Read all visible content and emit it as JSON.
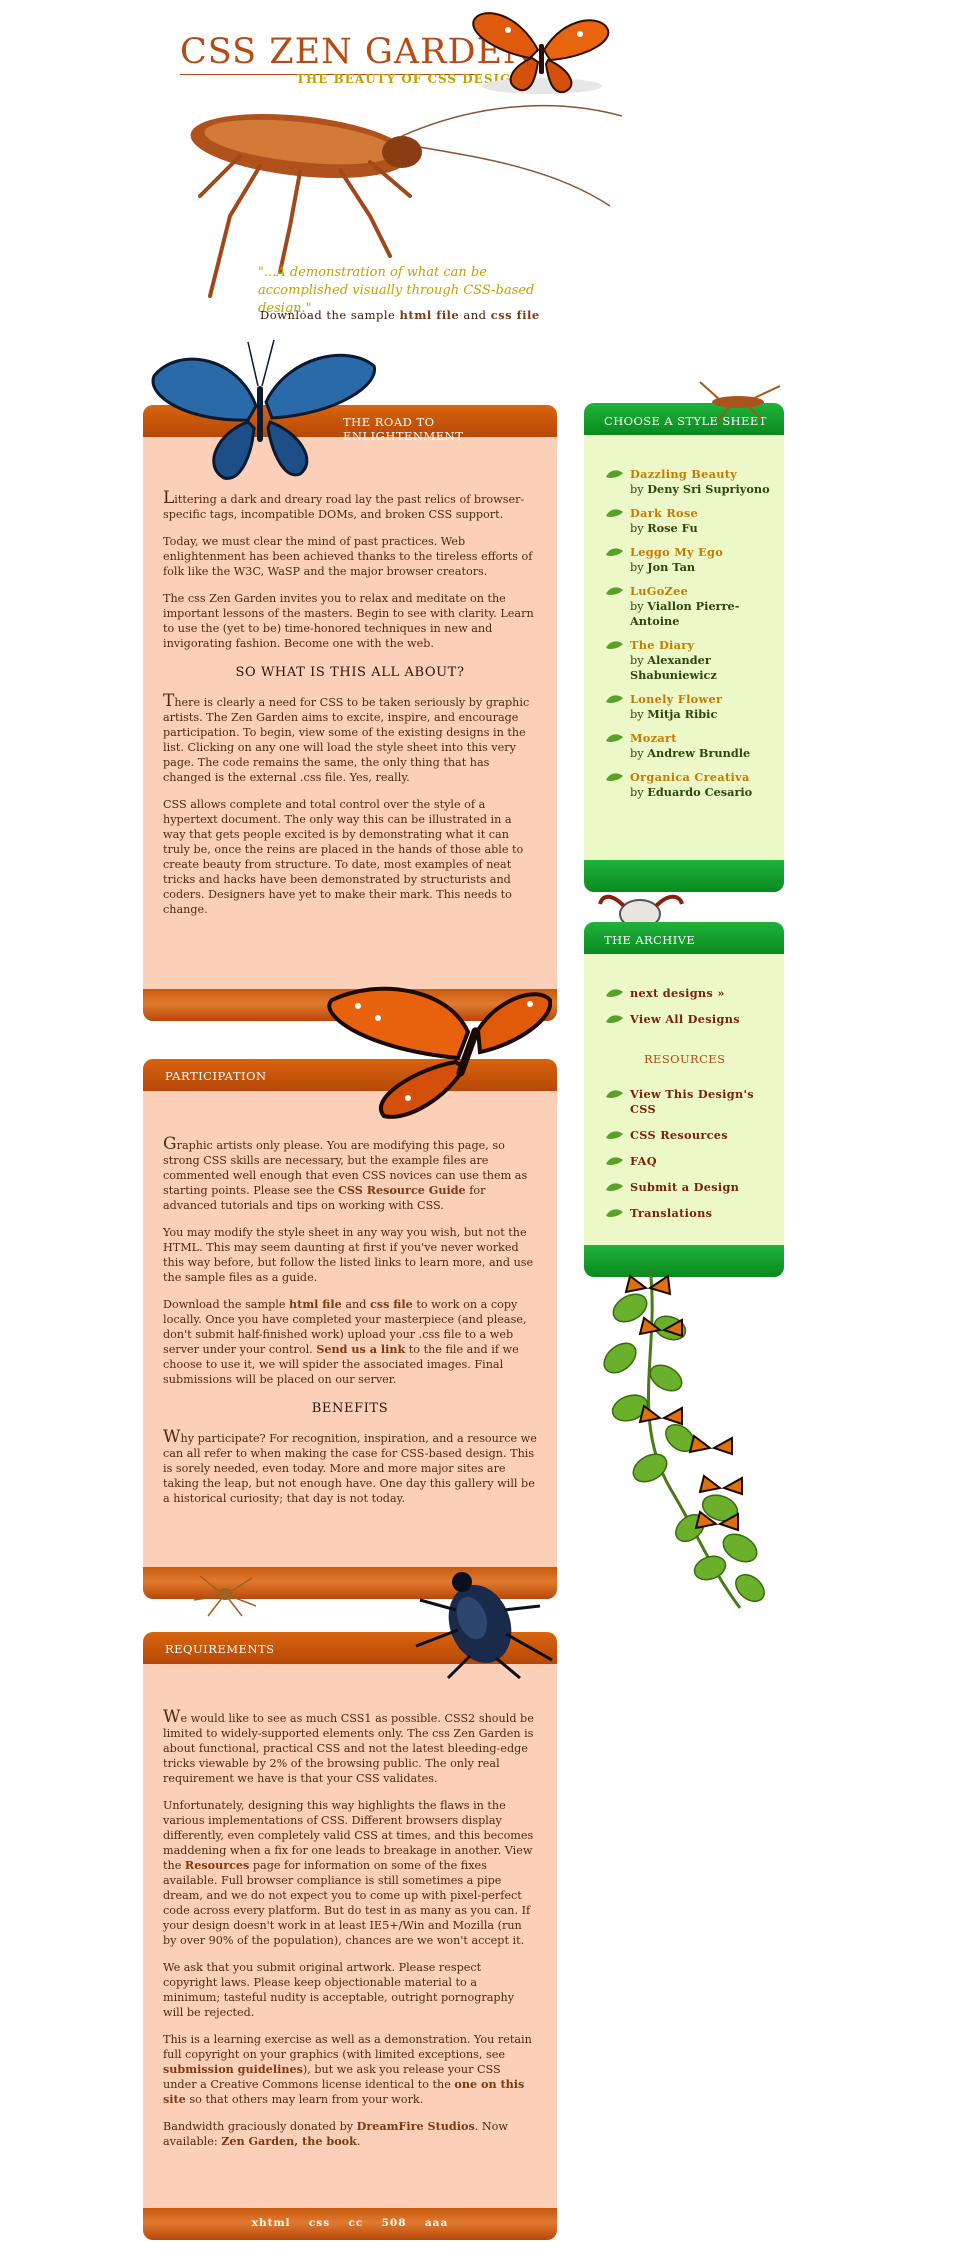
{
  "header": {
    "title": "CSS ZEN GARDEN",
    "tagline": "THE BEAUTY OF CSS DESIGN",
    "quote": "\"...A demonstration of what can be accomplished visually through CSS-based design.\"",
    "download_prefix": "Download the sample",
    "html_file": "html file",
    "and": "and",
    "css_file": "css file"
  },
  "intro": {
    "heading": "THE ROAD TO ENLIGHTENMENT",
    "p1_cap": "L",
    "p1": "ittering a dark and dreary road lay the past relics of browser-specific tags, incompatible DOMs, and broken CSS support.",
    "p2": "Today, we must clear the mind of past practices. Web enlightenment has been achieved thanks to the tireless efforts of folk like the W3C, WaSP and the major browser creators.",
    "p3": "The css Zen Garden invites you to relax and meditate on the important lessons of the masters. Begin to see with clarity. Learn to use the (yet to be) time-honored techniques in new and invigorating fashion. Become one with the web.",
    "sub_heading": "SO WHAT IS THIS ALL ABOUT?",
    "p4_cap": "T",
    "p4": "here is clearly a need for CSS to be taken seriously by graphic artists. The Zen Garden aims to excite, inspire, and encourage participation. To begin, view some of the existing designs in the list. Clicking on any one will load the style sheet into this very page. The code remains the same, the only thing that has changed is the external .css file. Yes, really.",
    "p5": "CSS allows complete and total control over the style of a hypertext document. The only way this can be illustrated in a way that gets people excited is by demonstrating what it can truly be, once the reins are placed in the hands of those able to create beauty from structure. To date, most examples of neat tricks and hacks have been demonstrated by structurists and coders. Designers have yet to make their mark. This needs to change."
  },
  "participation": {
    "heading": "PARTICIPATION",
    "p1_cap": "G",
    "p1_a": "raphic artists only please. You are modifying this page, so strong CSS skills are necessary, but the example files are commented well enough that even CSS novices can use them as starting points. Please see the",
    "p1_link": "CSS Resource Guide",
    "p1_b": "for advanced tutorials and tips on working with CSS.",
    "p2": "You may modify the style sheet in any way you wish, but not the HTML. This may seem daunting at first if you've never worked this way before, but follow the listed links to learn more, and use the sample files as a guide.",
    "p3_a": "Download the sample",
    "p3_html": "html file",
    "p3_and": "and",
    "p3_css": "css file",
    "p3_b": "to work on a copy locally. Once you have completed your masterpiece (and please, don't submit half-finished work) upload your .css file to a web server under your control.",
    "p3_link": "Send us a link",
    "p3_c": "to the file and if we choose to use it, we will spider the associated images. Final submissions will be placed on our server.",
    "benefits_heading": "BENEFITS",
    "p4_cap": "W",
    "p4": "hy participate? For recognition, inspiration, and a resource we can all refer to when making the case for CSS-based design. This is sorely needed, even today. More and more major sites are taking the leap, but not enough have. One day this gallery will be a historical curiosity; that day is not today."
  },
  "requirements": {
    "heading": "REQUIREMENTS",
    "p1_cap": "W",
    "p1": "e would like to see as much CSS1 as possible. CSS2 should be limited to widely-supported elements only. The css Zen Garden is about functional, practical CSS and not the latest bleeding-edge tricks viewable by 2% of the browsing public. The only real requirement we have is that your CSS validates.",
    "p2_a": "Unfortunately, designing this way highlights the flaws in the various implementations of CSS. Different browsers display differently, even completely valid CSS at times, and this becomes maddening when a fix for one leads to breakage in another. View the",
    "p2_link": "Resources",
    "p2_b": "page for information on some of the fixes available. Full browser compliance is still sometimes a pipe dream, and we do not expect you to come up with pixel-perfect code across every platform. But do test in as many as you can. If your design doesn't work in at least IE5+/Win and Mozilla (run by over 90% of the population), chances are we won't accept it.",
    "p3": "We ask that you submit original artwork. Please respect copyright laws. Please keep objectionable material to a minimum; tasteful nudity is acceptable, outright pornography will be rejected.",
    "p4_a": "This is a learning exercise as well as a demonstration. You retain full copyright on your graphics (with limited exceptions, see",
    "p4_link1": "submission guidelines",
    "p4_b": "), but we ask you release your CSS under a Creative Commons license identical to the",
    "p4_link2": "one on this site",
    "p4_c": "so that others may learn from your work.",
    "p5_a": "Bandwidth graciously donated by",
    "p5_link1": "DreamFire Studios",
    "p5_b": ". Now available:",
    "p5_link2": "Zen Garden, the book",
    "p5_c": "."
  },
  "footer_links": [
    "xhtml",
    "css",
    "cc",
    "508",
    "aaa"
  ],
  "style_sheets": {
    "heading": "CHOOSE A STYLE SHEET",
    "by": "by",
    "designs": [
      {
        "name": "Dazzling Beauty",
        "designer": "Deny Sri Supriyono"
      },
      {
        "name": "Dark Rose",
        "designer": "Rose Fu"
      },
      {
        "name": "Leggo My Ego",
        "designer": "Jon Tan"
      },
      {
        "name": "LuGoZee",
        "designer": "Viallon Pierre-Antoine"
      },
      {
        "name": "The Diary",
        "designer": "Alexander Shabuniewicz"
      },
      {
        "name": "Lonely Flower",
        "designer": "Mitja Ribic"
      },
      {
        "name": "Mozart",
        "designer": "Andrew Brundle"
      },
      {
        "name": "Organica Creativa",
        "designer": "Eduardo Cesario"
      }
    ]
  },
  "archive": {
    "heading": "THE ARCHIVE",
    "links": [
      "next designs »",
      "View All Designs"
    ],
    "resources_heading": "RESOURCES",
    "resources": [
      "View This Design's CSS",
      "CSS Resources",
      "FAQ",
      "Submit a Design",
      "Translations"
    ]
  },
  "colors": {
    "panel_bg": "#fcd0b8",
    "panel_header": "#c8580c",
    "sidebar_bg": "#ecf8c8",
    "sidebar_header": "#0f9a28",
    "title": "#b84a12",
    "tagline": "#c5a000"
  }
}
